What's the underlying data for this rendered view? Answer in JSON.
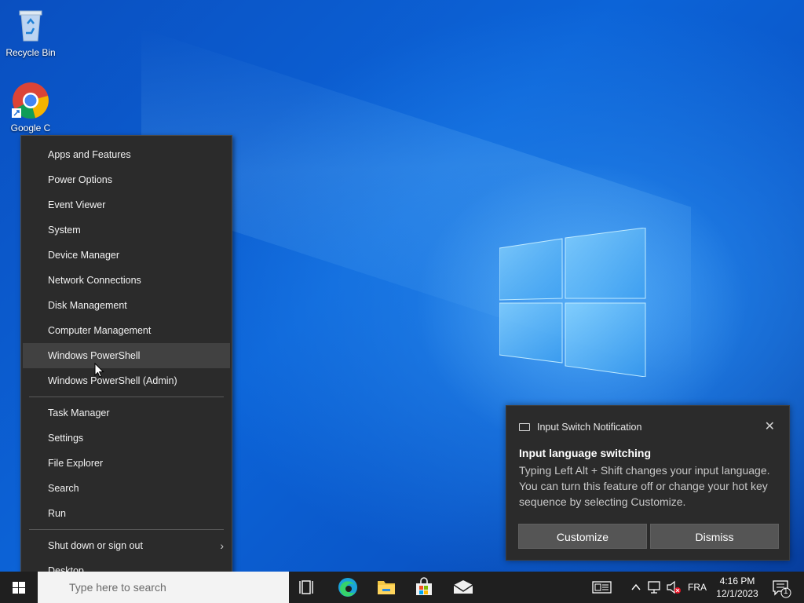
{
  "desktop": {
    "icons": [
      {
        "label": "Recycle Bin",
        "icon": "recycle-bin-icon"
      },
      {
        "label": "Google C",
        "icon": "chrome-icon"
      }
    ]
  },
  "context_menu": {
    "groups": [
      [
        "Apps and Features",
        "Power Options",
        "Event Viewer",
        "System",
        "Device Manager",
        "Network Connections",
        "Disk Management",
        "Computer Management",
        "Windows PowerShell",
        "Windows PowerShell (Admin)"
      ],
      [
        "Task Manager",
        "Settings",
        "File Explorer",
        "Search",
        "Run"
      ],
      [
        "Shut down or sign out",
        "Desktop"
      ]
    ],
    "highlighted": "Windows PowerShell",
    "submenu_arrow": "›"
  },
  "notification": {
    "app_name": "Input Switch Notification",
    "close_glyph": "✕",
    "title": "Input language switching",
    "body": "Typing Left Alt + Shift changes your input language. You can turn this feature off or change your hot key sequence by selecting Customize.",
    "buttons": {
      "customize": "Customize",
      "dismiss": "Dismiss"
    }
  },
  "taskbar": {
    "search_placeholder": "Type here to search",
    "pinned": [
      "task-view-icon",
      "edge-icon",
      "file-explorer-icon",
      "microsoft-store-icon",
      "mail-icon"
    ],
    "tray": {
      "language": "FRA",
      "time": "4:16 PM",
      "date": "12/1/2023",
      "notification_count": "1"
    }
  },
  "colors": {
    "menu_bg": "#2b2b2b",
    "menu_hover": "#414141",
    "taskbar_bg": "#1f1f1f",
    "wallpaper_blue": "#0c64d8"
  }
}
